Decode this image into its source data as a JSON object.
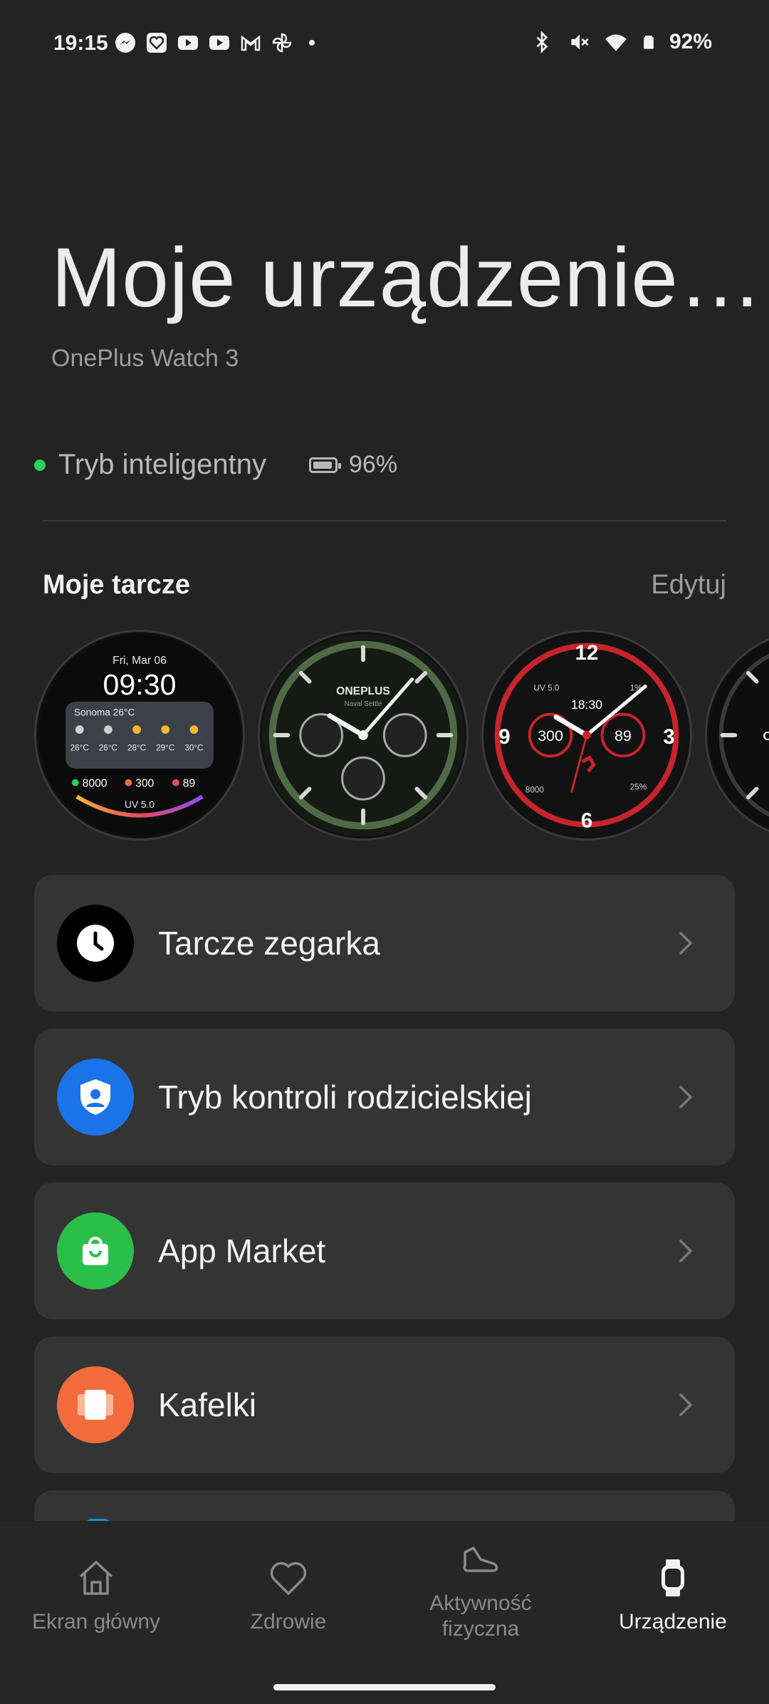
{
  "status_bar": {
    "time": "19:15",
    "battery_percent": "92%",
    "left_icons": [
      "messenger-icon",
      "health-icon",
      "youtube-icon",
      "youtube-icon",
      "gmail-icon",
      "pinwheel-icon"
    ],
    "right_icons": [
      "bluetooth-icon",
      "mute-icon",
      "wifi-icon",
      "battery-icon"
    ]
  },
  "header": {
    "title": "Moje urządzenie…",
    "device_name": "OnePlus Watch 3"
  },
  "status": {
    "mode": "Tryb inteligentny",
    "mode_color": "#2bd15a",
    "battery": "96%"
  },
  "watch_faces_section": {
    "title": "Moje tarcze",
    "edit_label": "Edytuj",
    "faces": [
      {
        "date": "Fri, Mar 06",
        "time": "09:30",
        "location": "Sonoma 26°C",
        "temps": [
          "26°C",
          "26°C",
          "28°C",
          "29°C",
          "30°C"
        ],
        "steps": "8000",
        "calories": "300",
        "heart": "89",
        "uv": "UV 5.0"
      },
      {
        "brand": "ONEPLUS",
        "sub": "Naval Settle"
      },
      {
        "time": "18:30",
        "left_value": "300",
        "right_value": "89",
        "uv": "UV 5.0",
        "steps": "8000",
        "percent_top": "1%",
        "percent_bottom": "25%",
        "numeral_12": "12",
        "numeral_3": "3",
        "numeral_6": "6",
        "numeral_9": "9"
      },
      {
        "brand": "ON"
      }
    ]
  },
  "menu": [
    {
      "label": "Tarcze zegarka",
      "icon": "clock-icon",
      "color": "#000000"
    },
    {
      "label": "Tryb kontroli rodzicielskiej",
      "icon": "shield-user-icon",
      "color": "#1a73e8"
    },
    {
      "label": "App Market",
      "icon": "shopping-bag-icon",
      "color": "#2bbf4a"
    },
    {
      "label": "Kafelki",
      "icon": "tiles-icon",
      "color": "#f26b3a"
    }
  ],
  "bottom_nav": [
    {
      "label": "Ekran główny",
      "icon": "home-icon",
      "active": false
    },
    {
      "label": "Zdrowie",
      "icon": "heart-icon",
      "active": false
    },
    {
      "label": "Aktywność fizyczna",
      "icon": "shoe-icon",
      "active": false
    },
    {
      "label": "Urządzenie",
      "icon": "watch-icon",
      "active": true
    }
  ]
}
